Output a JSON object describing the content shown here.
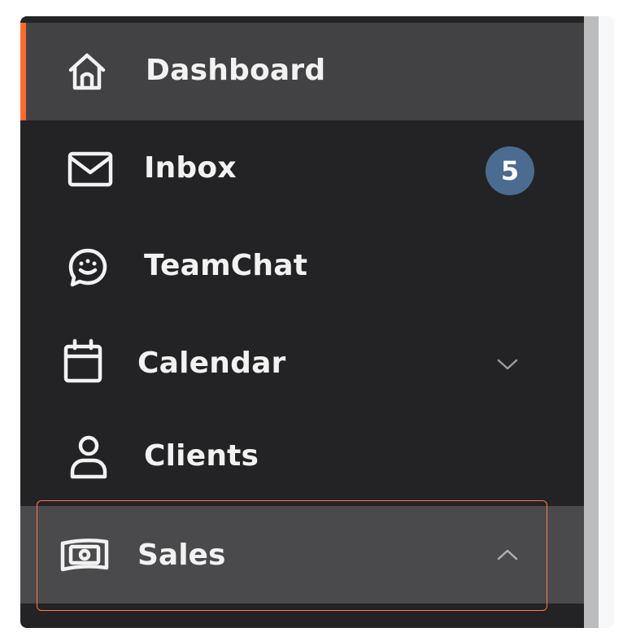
{
  "sidebar": {
    "items": [
      {
        "label": "Dashboard",
        "icon": "home-icon",
        "active": true
      },
      {
        "label": "Inbox",
        "icon": "mail-icon",
        "badge": "5"
      },
      {
        "label": "TeamChat",
        "icon": "chat-icon"
      },
      {
        "label": "Calendar",
        "icon": "calendar-icon",
        "expand": "chevron-down-icon"
      },
      {
        "label": "Clients",
        "icon": "user-icon"
      },
      {
        "label": "Sales",
        "icon": "cash-icon",
        "expand": "chevron-up-icon",
        "highlighted": true
      }
    ]
  },
  "colors": {
    "sidebar_bg": "#232325",
    "active_bg": "#424245",
    "active_indicator": "#ff6a2e",
    "badge_bg": "#4b6b91",
    "highlight_border": "#ff7a45"
  }
}
